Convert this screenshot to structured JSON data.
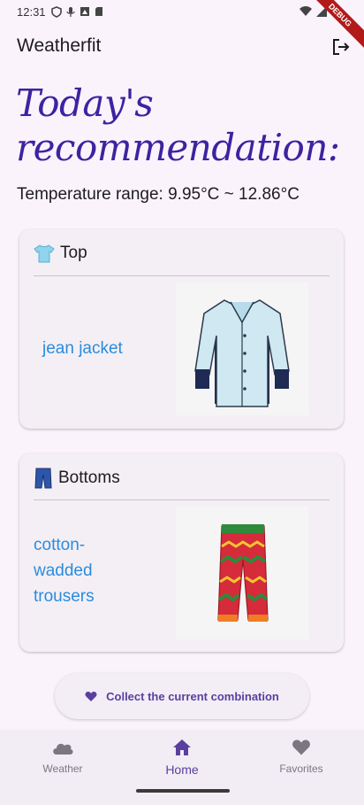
{
  "status_bar": {
    "time": "12:31",
    "debug_label": "DEBUG"
  },
  "app_bar": {
    "title": "Weatherfit",
    "logout_icon": "logout-icon"
  },
  "headline": {
    "line1": "Today's",
    "line2": "recommendation:"
  },
  "temperature": {
    "text": "Temperature range: 9.95°C ~ 12.86°C"
  },
  "cards": [
    {
      "category": "Top",
      "icon": "t-shirt-emoji",
      "item": "jean jacket"
    },
    {
      "category": "Bottoms",
      "icon": "jeans-emoji",
      "item_lines": [
        "cotton-",
        "wadded",
        "trousers"
      ]
    }
  ],
  "collect_button": {
    "label": "Collect the current combination",
    "icon": "heart-icon"
  },
  "nav": [
    {
      "label": "Weather",
      "icon": "cloud-icon"
    },
    {
      "label": "Home",
      "icon": "home-icon",
      "active": true
    },
    {
      "label": "Favorites",
      "icon": "heart-icon"
    }
  ],
  "colors": {
    "accent": "#5a3f9f",
    "headline": "#3d23a0",
    "link": "#2a8cdf",
    "background": "#fbf3fc"
  }
}
